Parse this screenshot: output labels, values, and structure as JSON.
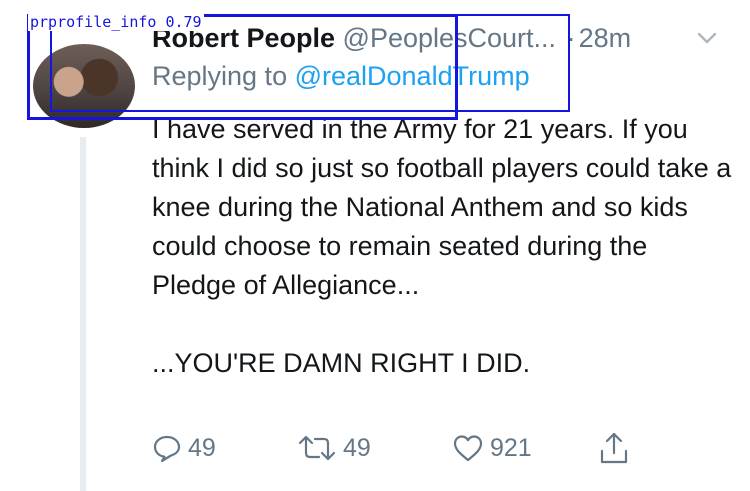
{
  "overlay": {
    "label": "prprofile_info 0.79"
  },
  "tweet": {
    "author": {
      "name": "Robert People",
      "handle": "@PeoplesCourt...",
      "time": "28m",
      "separator": "·"
    },
    "reply": {
      "prefix": "Replying to ",
      "mention": "@realDonaldTrump"
    },
    "body": {
      "paragraph1": "I have served in the Army for 21 years. If you think I did so just so football players could take a knee during the National Anthem and so kids could choose to remain seated during the Pledge of Allegiance...",
      "paragraph2": "...YOU'RE DAMN RIGHT I DID."
    },
    "actions": {
      "replies": "49",
      "retweets": "49",
      "likes": "921"
    }
  },
  "colors": {
    "text": "#14171a",
    "muted": "#657786",
    "link": "#1da1f2",
    "thread_line": "#e6ecf0",
    "overlay_box": "#1515e0"
  },
  "icons": [
    "chevron-down-icon",
    "reply-icon",
    "retweet-icon",
    "like-icon",
    "share-icon"
  ]
}
